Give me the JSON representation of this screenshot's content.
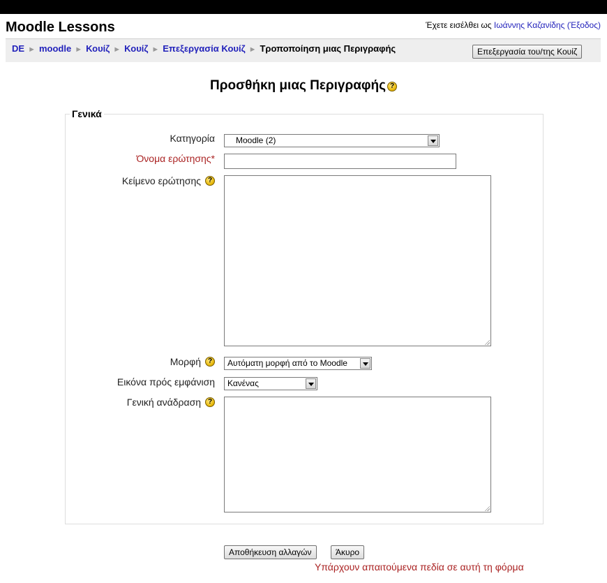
{
  "site": {
    "title": "Moodle Lessons"
  },
  "login": {
    "prefix": "Έχετε εισέλθει ως ",
    "user": "Ιωάννης Καζανίδης",
    "logout": "(Έξοδος)"
  },
  "breadcrumb": {
    "items": [
      "DE",
      "moodle",
      "Κουίζ",
      "Κουίζ",
      "Επεξεργασία Κουίζ"
    ],
    "current": "Τροποποίηση μιας Περιγραφής",
    "separator": "►"
  },
  "nav_button": "Επεξεργασία του/της Κουίζ",
  "page": {
    "heading": "Προσθήκη μιας Περιγραφής"
  },
  "form": {
    "legend": "Γενικά",
    "category": {
      "label": "Κατηγορία",
      "value": "Moodle (2)"
    },
    "name": {
      "label": "Όνομα ερώτησης*",
      "value": ""
    },
    "text": {
      "label": "Κείμενο ερώτησης",
      "value": ""
    },
    "format": {
      "label": "Μορφή",
      "value": "Αυτόματη μορφή από το Moodle"
    },
    "image": {
      "label": "Εικόνα πρός εμφάνιση",
      "value": "Κανένας"
    },
    "feedback": {
      "label": "Γενική ανάδραση",
      "value": ""
    }
  },
  "buttons": {
    "save": "Αποθήκευση αλλαγών",
    "cancel": "Άκυρο"
  },
  "missing_fields_note": "Υπάρχουν απαιτούμενα πεδία σε αυτή τη φόρμα",
  "icons": {
    "help": "help-icon"
  },
  "colors": {
    "link": "#2222bb",
    "required": "#aa2222",
    "navbar_bg": "#eeeeee"
  }
}
